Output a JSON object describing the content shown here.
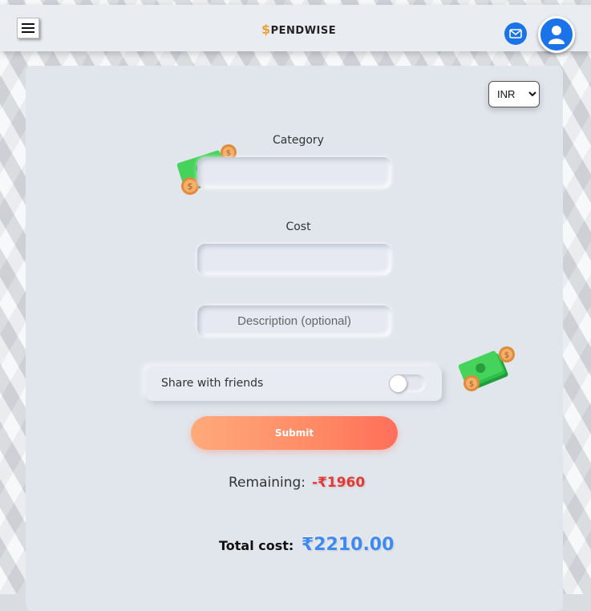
{
  "header": {
    "brand_prefix": "$",
    "brand": "PENDWISE"
  },
  "form": {
    "currency": {
      "selected": "INR",
      "options": [
        "INR"
      ]
    },
    "category_label": "Category",
    "category_value": "",
    "cost_label": "Cost",
    "cost_value": "",
    "description_placeholder": "Description (optional)",
    "share_label": "Share with friends",
    "share_enabled": false,
    "submit_label": "Submit"
  },
  "summary": {
    "remaining_label": "Remaining:",
    "remaining_value": "-₹1960",
    "total_label": "Total cost:",
    "total_value": "₹2210.00"
  },
  "colors": {
    "accent_blue": "#1a73e8",
    "negative_red": "#e53935",
    "total_blue": "#3d8bf0",
    "submit_gradient_start": "#ffaa7a",
    "submit_gradient_end": "#ff6f5a"
  },
  "icons": [
    "menu-icon",
    "mail-icon",
    "user-icon",
    "money-stack-icon"
  ]
}
